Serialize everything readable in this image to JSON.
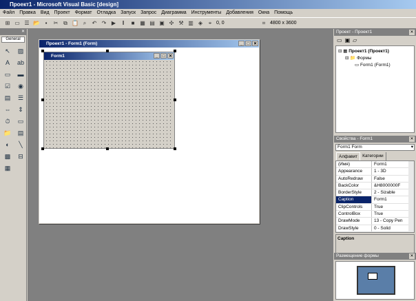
{
  "title": "Проект1 - Microsoft Visual Basic [design]",
  "menu": [
    "Файл",
    "Правка",
    "Вид",
    "Проект",
    "Формат",
    "Отладка",
    "Запуск",
    "Запрос",
    "Диаграмма",
    "Инструменты",
    "Добавления",
    "Окна",
    "Помощь"
  ],
  "toolbar": {
    "coords": "0, 0",
    "size": "4800 x 3600"
  },
  "toolbox": {
    "tab": "General"
  },
  "project_window": {
    "title": "Проект1 - Form1 (Form)",
    "form_title": "Form1"
  },
  "explorer": {
    "title": "Проект - Проект1",
    "root": "Проект1 (Проект1)",
    "folder": "Формы",
    "item": "Form1 (Form1)"
  },
  "properties": {
    "title": "Свойства - Form1",
    "object": "Form1 Form",
    "tabs": [
      "Алфавит",
      "Категории"
    ],
    "rows": [
      [
        "(Имя)",
        "Form1"
      ],
      [
        "Appearance",
        "1 - 3D"
      ],
      [
        "AutoRedraw",
        "False"
      ],
      [
        "BackColor",
        "&H8000000F"
      ],
      [
        "BorderStyle",
        "2 - Sizable"
      ],
      [
        "Caption",
        "Form1"
      ],
      [
        "ClipControls",
        "True"
      ],
      [
        "ControlBox",
        "True"
      ],
      [
        "DrawMode",
        "13 - Copy Pen"
      ],
      [
        "DrawStyle",
        "0 - Solid"
      ]
    ],
    "selected": "Caption",
    "desc": "Caption"
  },
  "layout": {
    "title": "Размещение формы"
  }
}
